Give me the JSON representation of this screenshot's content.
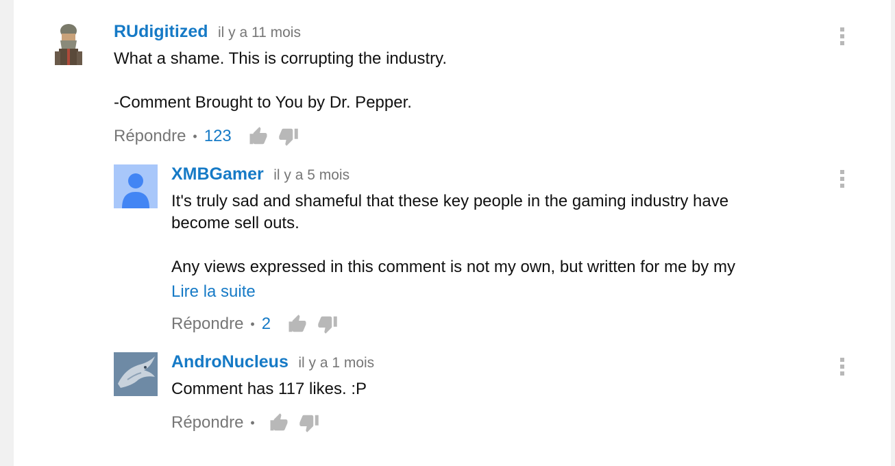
{
  "comments": [
    {
      "author": "RUdigitized",
      "time": "il y a 11 mois",
      "lines": [
        "What a shame. This is corrupting the industry.",
        "",
        "-Comment Brought to You by Dr. Pepper."
      ],
      "reply_label": "Répondre",
      "separator": "•",
      "likes": "123",
      "avatar_icon": "dwarf-avatar-icon"
    },
    {
      "author": "XMBGamer",
      "time": "il y a 5 mois",
      "lines": [
        "It's truly sad and shameful that these key people in the gaming industry have",
        "become sell outs.",
        "",
        "Any views expressed in this comment is not my own, but written for me by my"
      ],
      "read_more": "Lire la suite",
      "reply_label": "Répondre",
      "separator": "•",
      "likes": "2",
      "avatar_icon": "default-user-avatar-icon"
    },
    {
      "author": "AndroNucleus",
      "time": "il y a 1 mois",
      "lines": [
        "Comment has 117 likes. :P"
      ],
      "reply_label": "Répondre",
      "separator": "•",
      "likes": "",
      "avatar_icon": "dragon-avatar-icon"
    }
  ],
  "colors": {
    "link": "#167ac6",
    "muted": "#767676",
    "icon_gray": "#b8b8b8",
    "avatar_blue_bg": "#a8c7fa",
    "avatar_blue_fg": "#4285f4"
  }
}
